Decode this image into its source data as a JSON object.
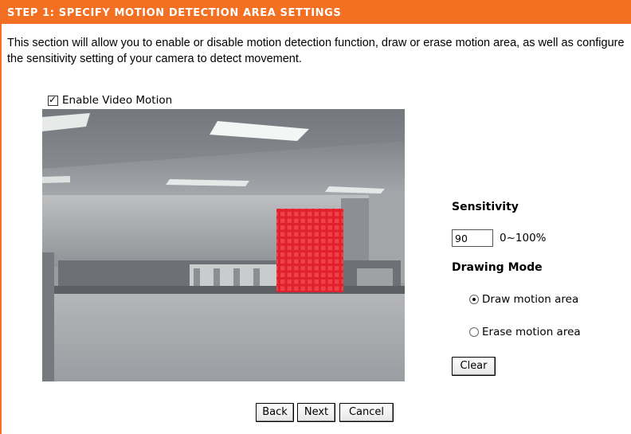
{
  "header": {
    "title": "STEP 1: SPECIFY MOTION DETECTION AREA SETTINGS"
  },
  "description": "This section will allow you to enable or disable motion detection function, draw or erase motion area, as well as configure the sensitivity setting of your camera to detect movement.",
  "enable_motion": {
    "label": "Enable Video Motion",
    "checked": true
  },
  "video": {
    "alt": "camera live view"
  },
  "sensitivity": {
    "label": "Sensitivity",
    "value": "90",
    "range": "0~100%"
  },
  "drawing_mode": {
    "label": "Drawing Mode",
    "options": [
      {
        "label": "Draw motion area",
        "selected": true
      },
      {
        "label": "Erase motion area",
        "selected": false
      }
    ]
  },
  "buttons": {
    "clear": "Clear",
    "back": "Back",
    "next": "Next",
    "cancel": "Cancel"
  },
  "colors": {
    "header_bg": "#f36f21",
    "motion_area": "#e0202a"
  }
}
